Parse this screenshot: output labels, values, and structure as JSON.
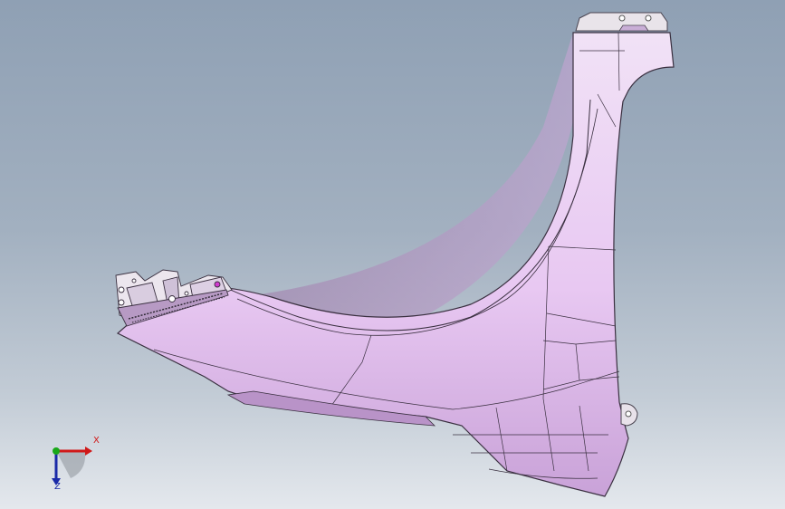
{
  "viewport": {
    "background_top": "#8fa0b4",
    "background_bottom": "#e4e8ed"
  },
  "model": {
    "part": "fender-panel",
    "surface_color": "#e6c9f0",
    "edge_color": "#3a3040"
  },
  "triad": {
    "x_label": "X",
    "z_label": "Z",
    "x_color": "#d01818",
    "y_color": "#18a818",
    "z_color": "#1a2aa8"
  }
}
